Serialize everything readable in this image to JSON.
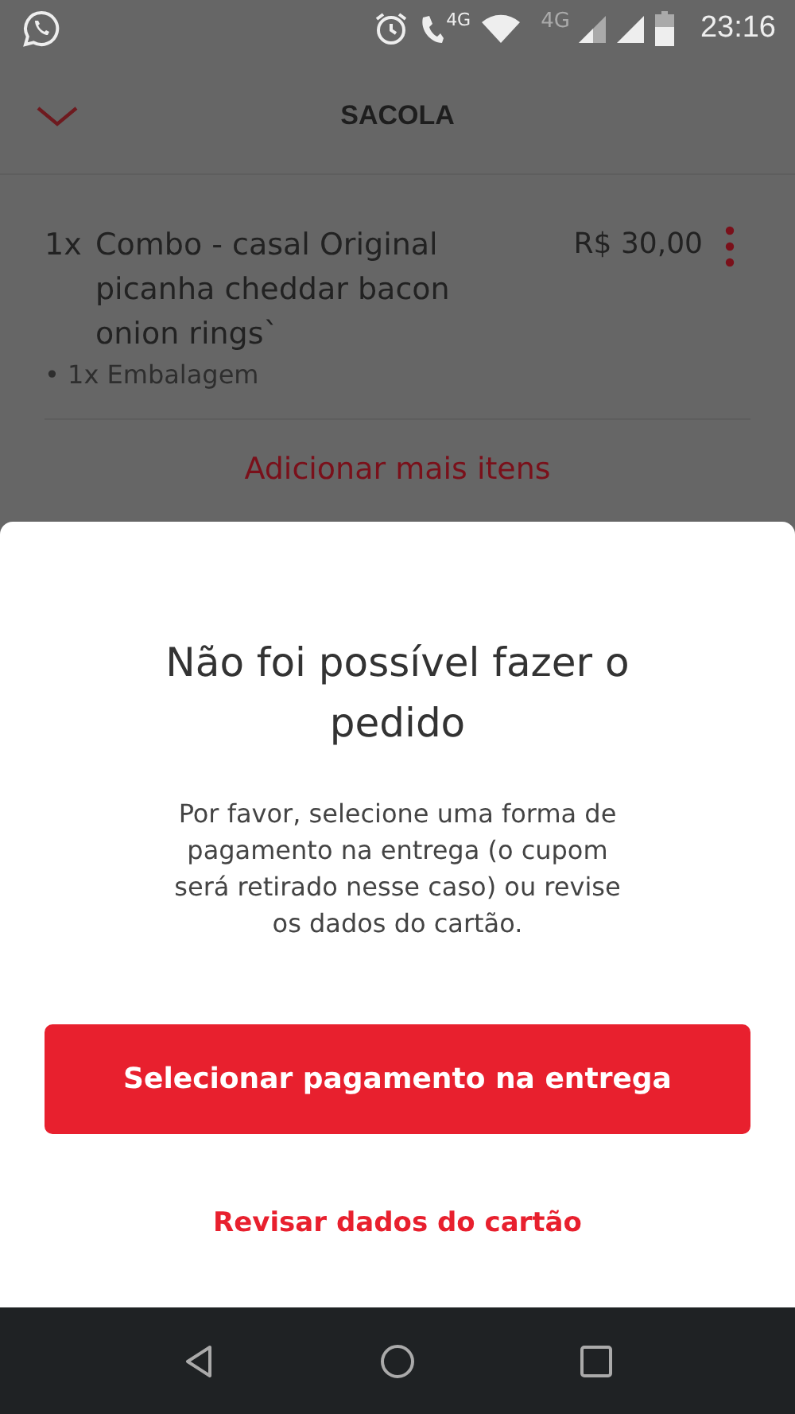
{
  "status_bar": {
    "call_network": "4G",
    "data_network": "4G",
    "time": "23:16"
  },
  "header": {
    "title": "SACOLA"
  },
  "items": [
    {
      "quantity": "1x",
      "name": "Combo - casal Original picanha cheddar bacon onion rings`",
      "price": "R$ 30,00",
      "extras": [
        "• 1x Embalagem"
      ]
    }
  ],
  "add_more": "Adicionar mais itens",
  "dialog": {
    "title": "Não foi possível fazer o pedido",
    "message": "Por favor, selecione uma forma de pagamento na entrega (o cupom será retirado nesse caso) ou revise os dados do cartão.",
    "primary_button": "Selecionar pagamento na entrega",
    "secondary_button": "Revisar dados do cartão"
  }
}
